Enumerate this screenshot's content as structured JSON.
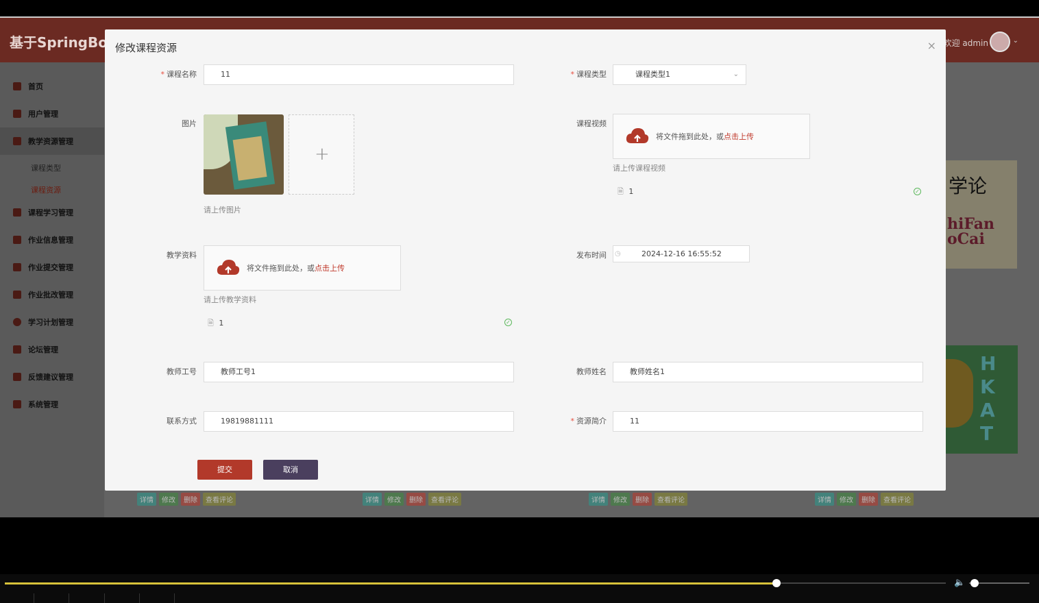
{
  "app": {
    "brand": "基于SpringBoot",
    "welcome": "欢迎 admin"
  },
  "sidebar": {
    "items": [
      {
        "label": "首页"
      },
      {
        "label": "用户管理"
      },
      {
        "label": "教学资源管理"
      },
      {
        "label": "课程学习管理"
      },
      {
        "label": "作业信息管理"
      },
      {
        "label": "作业提交管理"
      },
      {
        "label": "作业批改管理"
      },
      {
        "label": "学习计划管理"
      },
      {
        "label": "论坛管理"
      },
      {
        "label": "反馈建议管理"
      },
      {
        "label": "系统管理"
      }
    ],
    "subitems": [
      {
        "label": "课程类型"
      },
      {
        "label": "课程资源"
      }
    ]
  },
  "background": {
    "deco1_line1": "学论",
    "deco1_line2": "hiFan",
    "deco1_line3": "oCai",
    "card_actions": [
      "详情",
      "修改",
      "删除",
      "查看评论"
    ]
  },
  "modal": {
    "title": "修改课程资源",
    "close": "×",
    "fields": {
      "course_name": {
        "label": "课程名称",
        "value": "11"
      },
      "course_type": {
        "label": "课程类型",
        "value": "课程类型1"
      },
      "image": {
        "label": "图片",
        "hint": "请上传图片"
      },
      "course_video": {
        "label": "课程视频",
        "upload_text": "将文件拖到此处，或",
        "upload_link": "点击上传",
        "hint": "请上传课程视频",
        "file": "1"
      },
      "materials": {
        "label": "教学资料",
        "upload_text": "将文件拖到此处，或",
        "upload_link": "点击上传",
        "hint": "请上传教学资料",
        "file": "1"
      },
      "publish_time": {
        "label": "发布时间",
        "value": "2024-12-16 16:55:52"
      },
      "teacher_id": {
        "label": "教师工号",
        "value": "教师工号1"
      },
      "teacher_name": {
        "label": "教师姓名",
        "value": "教师姓名1"
      },
      "contact": {
        "label": "联系方式",
        "value": "19819881111"
      },
      "intro": {
        "label": "资源简介",
        "value": "11"
      }
    },
    "submit": "提交",
    "cancel": "取消"
  },
  "media": {
    "progress": 0.75,
    "volume": 0.05
  },
  "colors": {
    "accent": "#b2392a",
    "cancel": "#4a3f5e",
    "header": "#6b2a22"
  }
}
